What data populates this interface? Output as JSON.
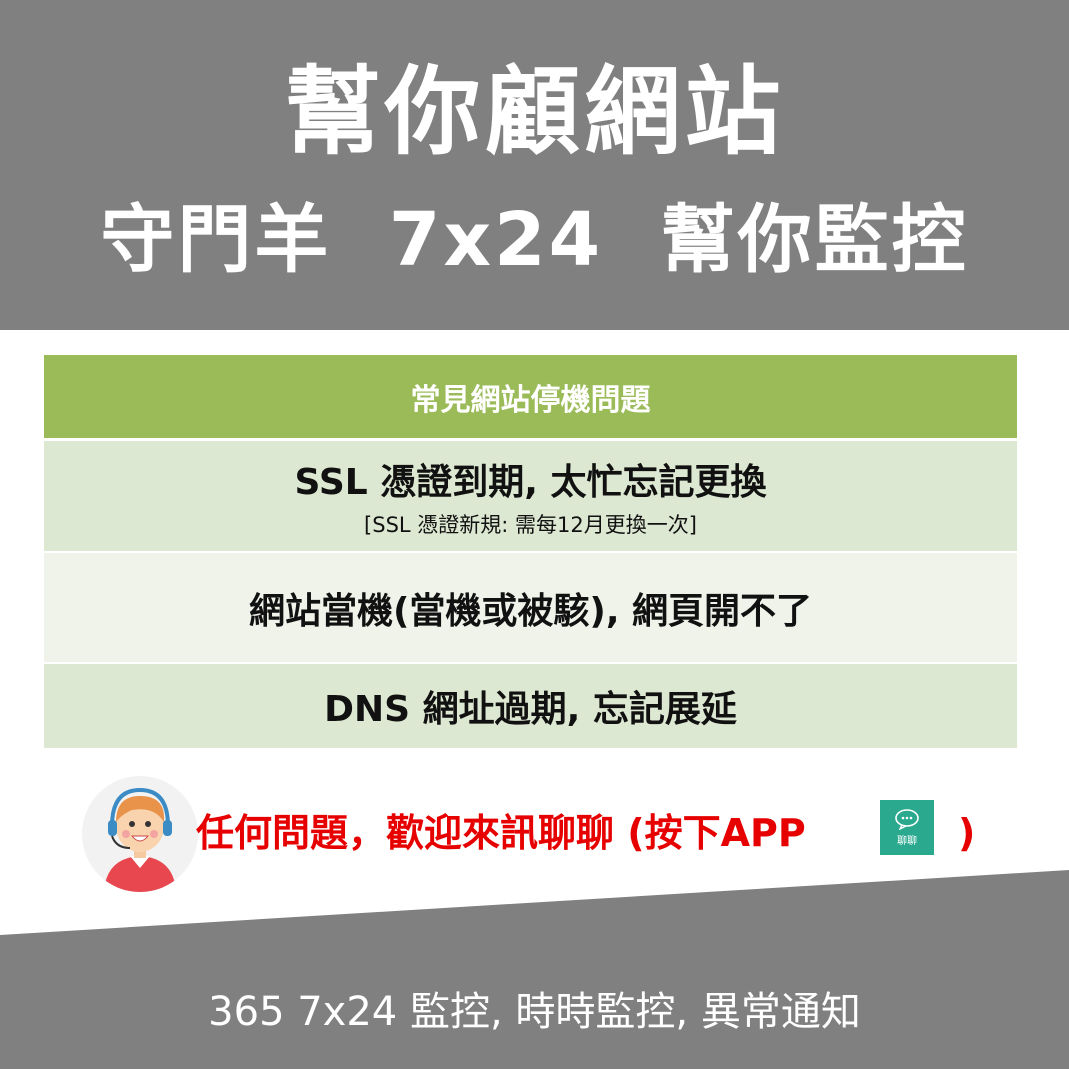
{
  "header": {
    "title": "幫你顧網站",
    "subtitle": "守門羊  7x24  幫你監控"
  },
  "table": {
    "heading": "常見網站停機問題",
    "rows": [
      {
        "main": "SSL 憑證到期, 太忙忘記更換",
        "sub": "[SSL 憑證新規: 需每12月更換一次]"
      },
      {
        "main": "網站當機(當機或被駭), 網頁開不了"
      },
      {
        "main": "DNS 網址過期, 忘記展延"
      }
    ]
  },
  "contact": {
    "text": "任何問題，歡迎來訊聊聊 (按下APP",
    "close_paren": ")",
    "app_icon_label": "聊聊"
  },
  "footer": {
    "text": "365 7x24 監控, 時時監控, 異常通知"
  },
  "colors": {
    "band": "#808080",
    "header_green": "#9bbb59",
    "row_dark": "#dde8d2",
    "row_light": "#eff3ea",
    "accent_red": "#e60000",
    "app_green": "#2aa98f"
  }
}
